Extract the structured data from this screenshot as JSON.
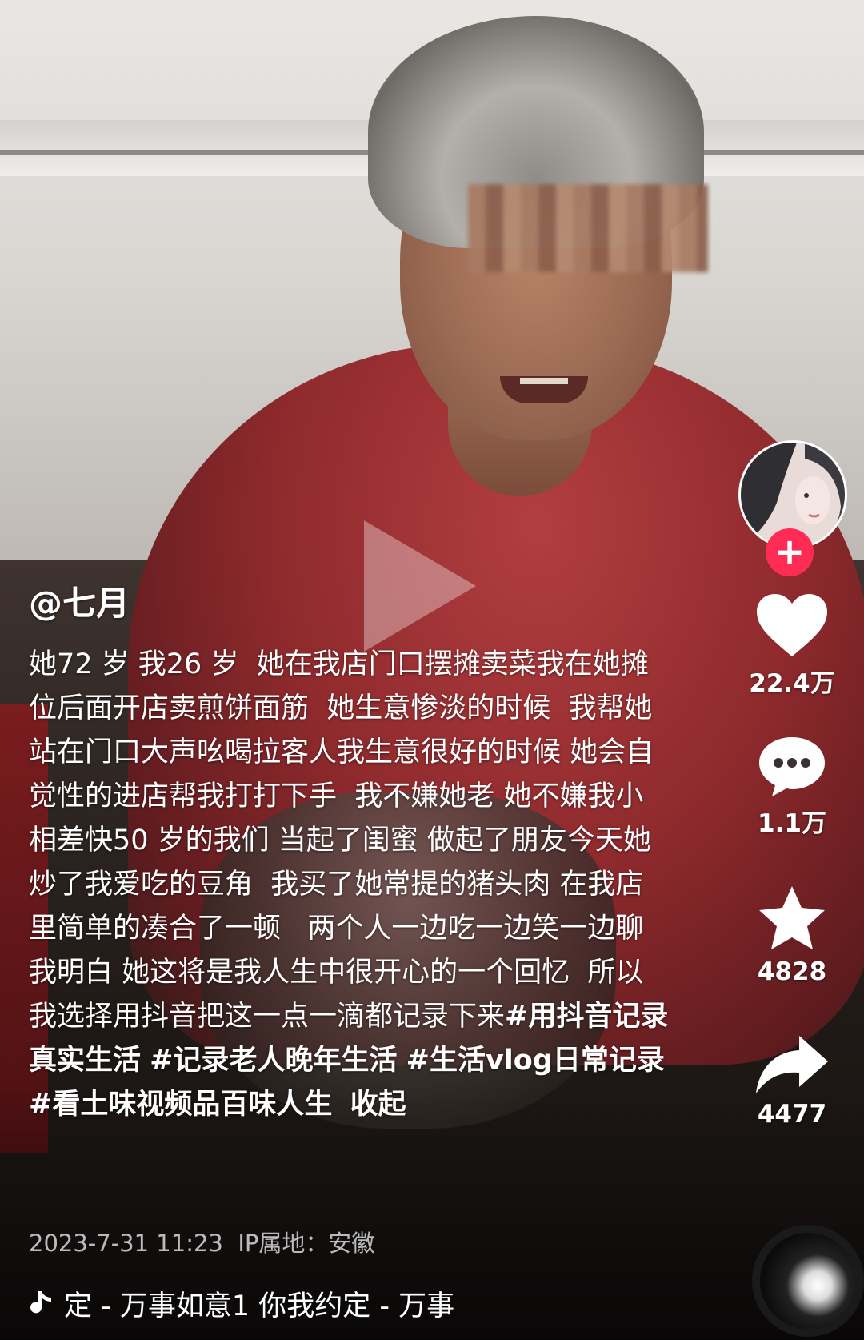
{
  "creator": {
    "username": "@七月"
  },
  "caption": {
    "text": "她72 岁 我26 岁  她在我店门口摆摊卖菜我在她摊位后面开店卖煎饼面筋  她生意惨淡的时候  我帮她站在门口大声吆喝拉客人我生意很好的时候 她会自觉性的进店帮我打打下手  我不嫌她老 她不嫌我小 相差快50 岁的我们 当起了闺蜜 做起了朋友今天她炒了我爱吃的豆角  我买了她常提的猪头肉 在我店里简单的凑合了一顿   两个人一边吃一边笑一边聊  我明白 她这将是我人生中很开心的一个回忆  所以我选择用抖音把这一点一滴都记录下来",
    "hashtags": [
      "#用抖音记录真实生活",
      "#记录老人晚年生活",
      "#生活vlog日常记录",
      "#看土味视频品百味人生"
    ],
    "collapse_label": "收起"
  },
  "meta": {
    "date": "2023-7-31 11:23",
    "ip_label": "IP属地：安徽"
  },
  "music": {
    "title": "定 - 万事如意1   你我约定 - 万事",
    "icon": "music-note-icon"
  },
  "actions": {
    "like_count": "22.4万",
    "comment_count": "1.1万",
    "favorite_count": "4828",
    "share_count": "4477"
  },
  "colors": {
    "follow_button": "#fe2c55",
    "text": "#ffffff"
  }
}
